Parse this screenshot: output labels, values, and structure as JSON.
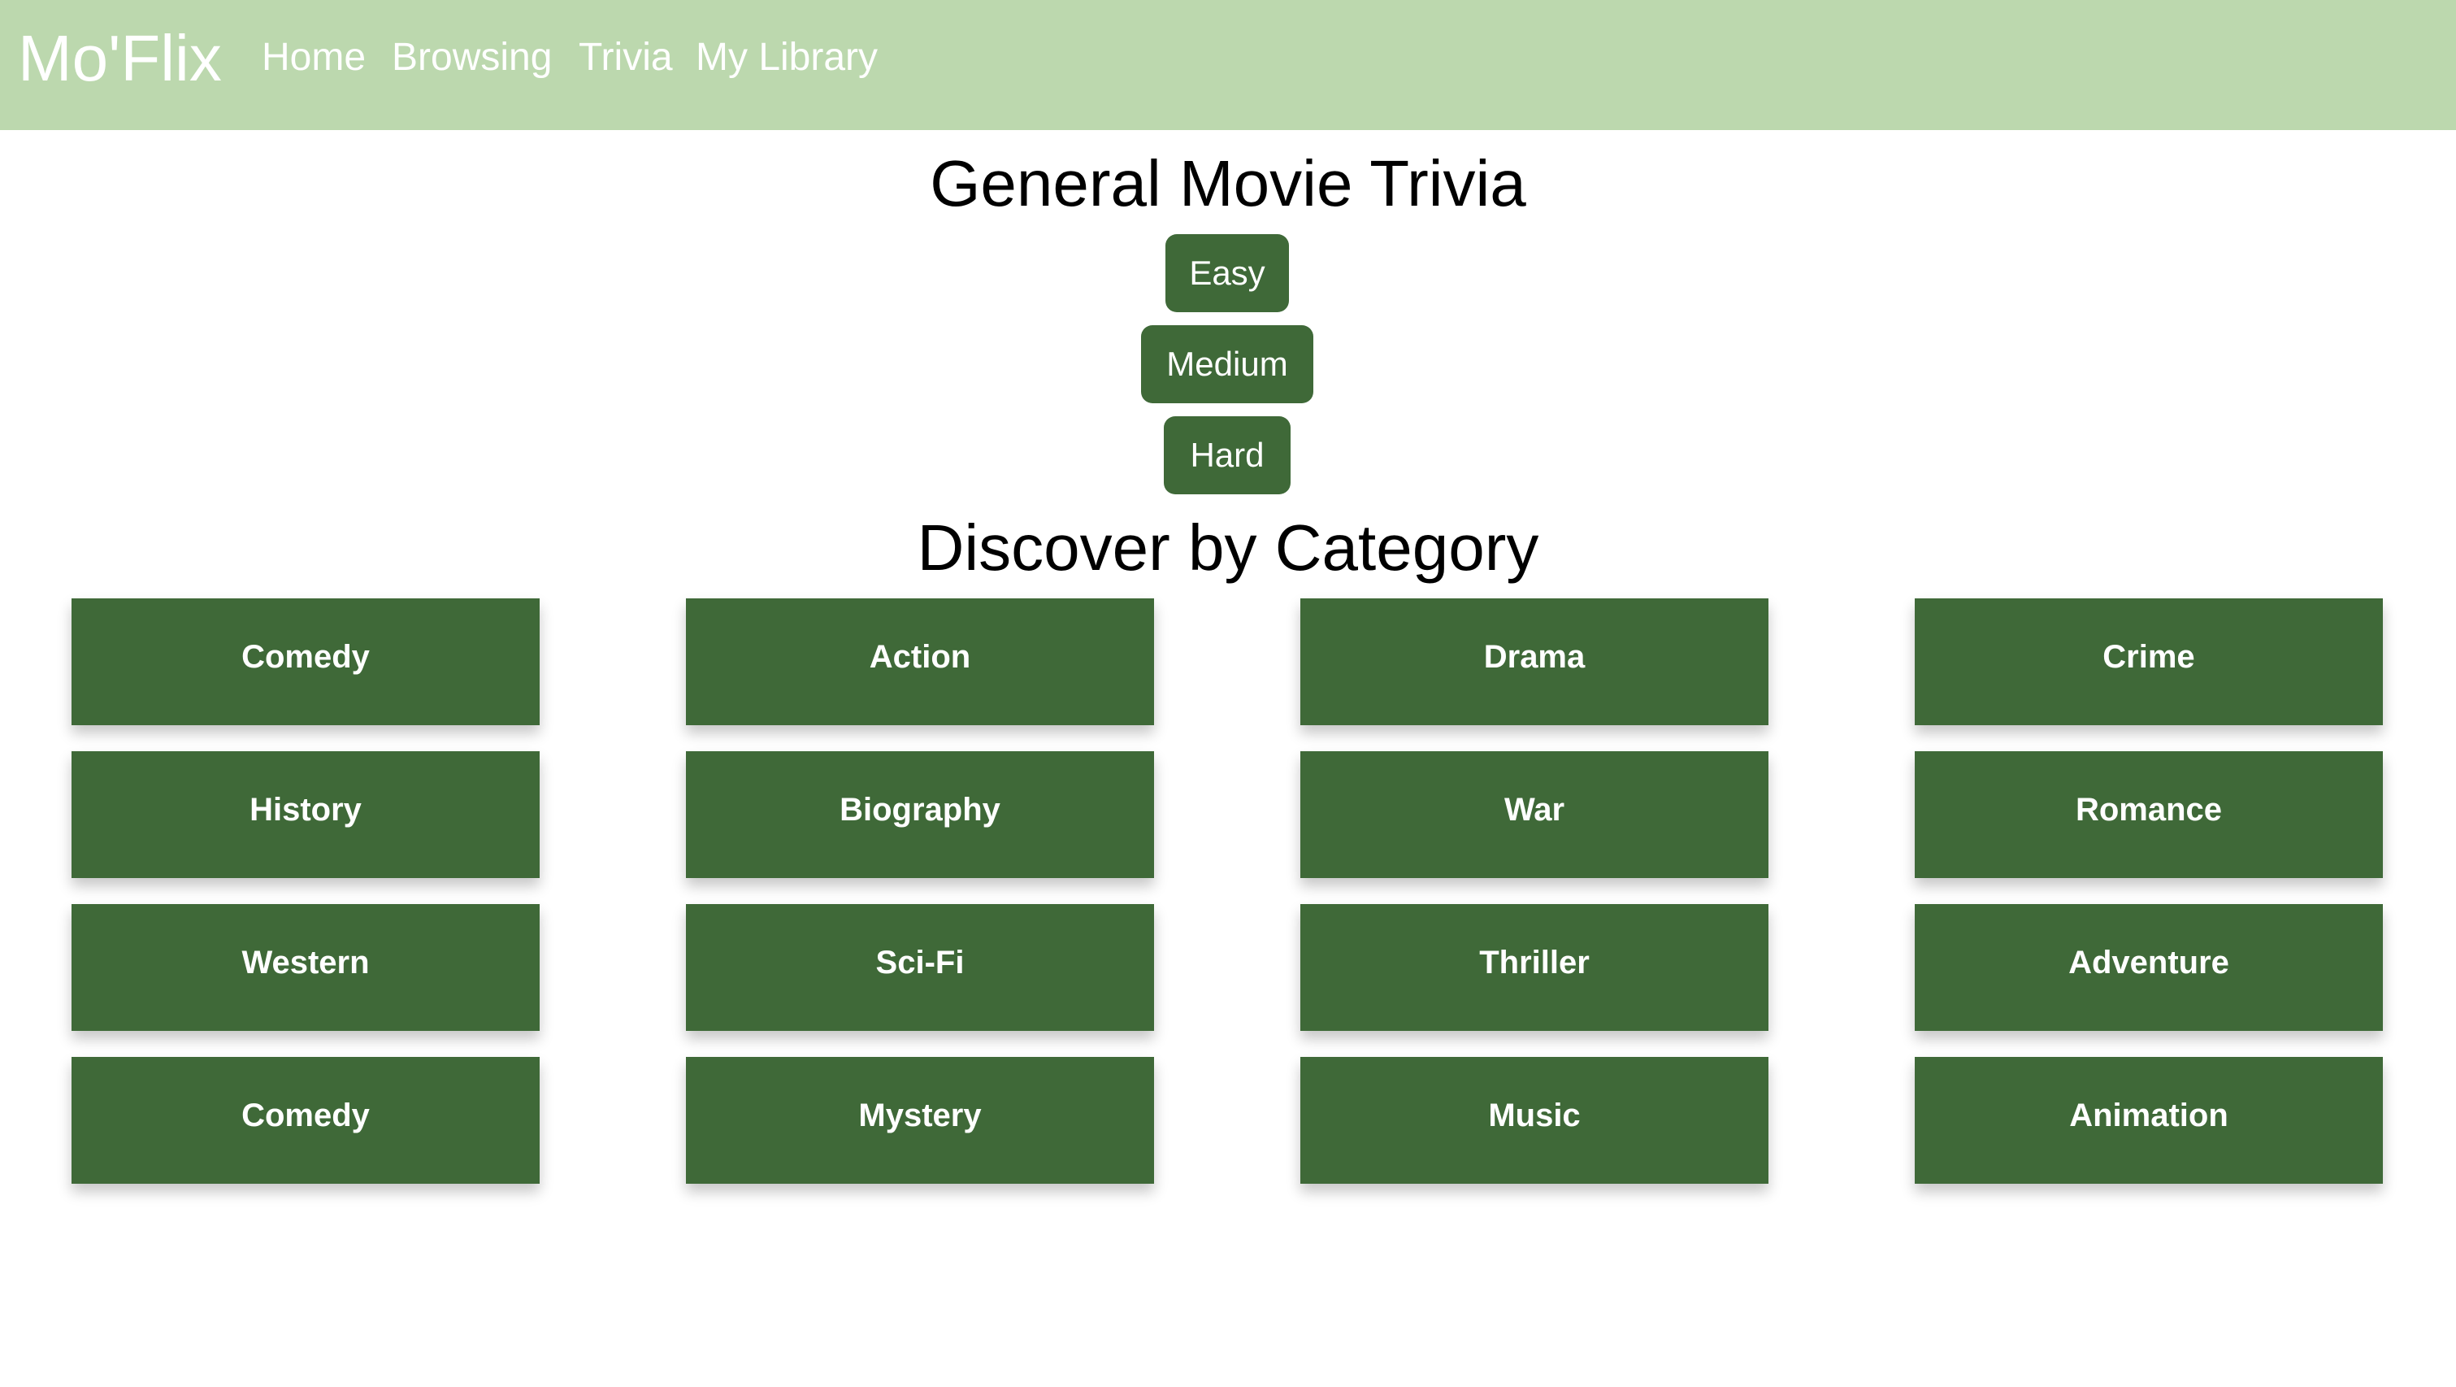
{
  "nav": {
    "brand": "Mo'Flix",
    "links": [
      "Home",
      "Browsing",
      "Trivia",
      "My Library"
    ]
  },
  "trivia": {
    "title": "General Movie Trivia",
    "difficulties": [
      "Easy",
      "Medium",
      "Hard"
    ]
  },
  "categories": {
    "title": "Discover by Category",
    "items": [
      "Comedy",
      "Action",
      "Drama",
      "Crime",
      "History",
      "Biography",
      "War",
      "Romance",
      "Western",
      "Sci-Fi",
      "Thriller",
      "Adventure",
      "Comedy",
      "Mystery",
      "Music",
      "Animation"
    ]
  },
  "colors": {
    "navbar_bg": "#bcd8ae",
    "button_bg": "#3f6938",
    "button_text": "#ffffff"
  }
}
